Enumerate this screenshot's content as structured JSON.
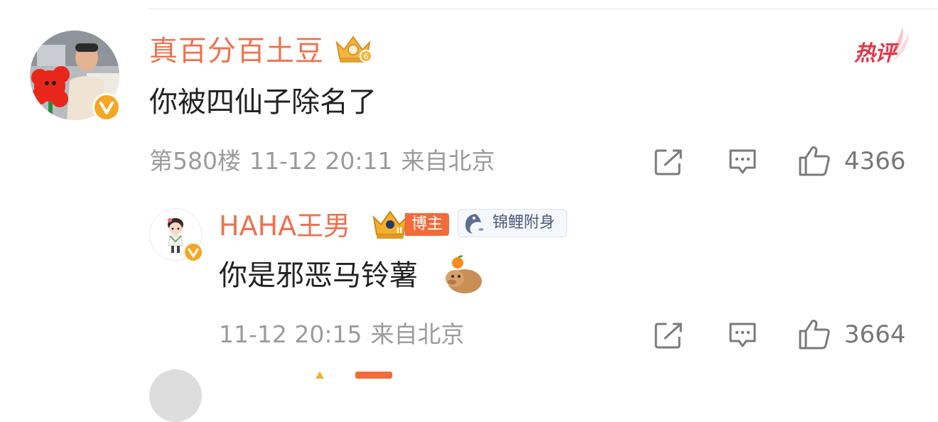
{
  "main_comment": {
    "username": "真百分百土豆",
    "hot_badge": "热评",
    "text": "你被四仙子除名了",
    "floor": "第580楼",
    "time": "11-12 20:11",
    "location": "来自北京",
    "like_count": "4366",
    "crown_level": "6"
  },
  "reply": {
    "username": "HAHA王男",
    "blogger_tag": "博主",
    "koi_tag": "锦鲤附身",
    "text": "你是邪恶马铃薯",
    "time": "11-12 20:15",
    "location": "来自北京",
    "like_count": "3664",
    "crown_level": "II"
  },
  "icons": {
    "share": "share-edit-icon",
    "comment": "comment-icon",
    "like": "thumbs-up-icon",
    "verified": "verified-v-badge-icon",
    "crown": "crown-icon",
    "koi": "koi-fish-icon",
    "capybara": "capybara-emoji"
  },
  "colors": {
    "username": "#eb7350",
    "meta": "#9b9b9b",
    "hot": "#e0384a",
    "verified": "#f5a623",
    "blogger_tag": "#f26b3a"
  }
}
